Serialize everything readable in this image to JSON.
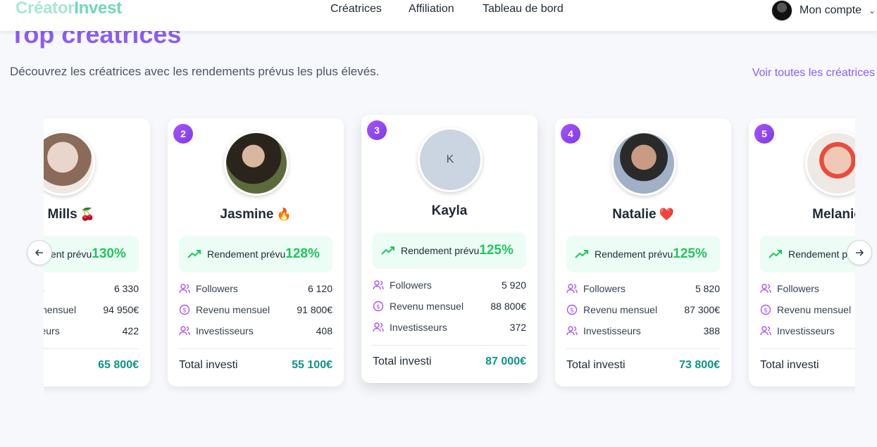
{
  "brand": {
    "part1": "Créator",
    "part2": "Invest"
  },
  "nav": {
    "links": [
      "Créatrices",
      "Affiliation",
      "Tableau de bord"
    ],
    "account_label": "Mon compte"
  },
  "page": {
    "title": "Top créatrices",
    "subtitle": "Découvrez les créatrices avec les rendements prévus les plus élevés.",
    "see_all": "Voir toutes les créatrices"
  },
  "labels": {
    "yield": "Rendement prévu",
    "followers": "Followers",
    "revenue": "Revenu mensuel",
    "investors": "Investisseurs",
    "total": "Total investi"
  },
  "creators": [
    {
      "rank": "",
      "name": "ke Mills",
      "emoji": "🍒",
      "yield": "130%",
      "followers": "6 330",
      "revenue": "94 950€",
      "investors": "422",
      "total": "65 800€",
      "initial": ""
    },
    {
      "rank": "2",
      "name": "Jasmine",
      "emoji": "🔥",
      "yield": "128%",
      "followers": "6 120",
      "revenue": "91 800€",
      "investors": "408",
      "total": "55 100€",
      "initial": ""
    },
    {
      "rank": "3",
      "name": "Kayla",
      "emoji": "",
      "yield": "125%",
      "followers": "5 920",
      "revenue": "88 800€",
      "investors": "372",
      "total": "87 000€",
      "initial": "K"
    },
    {
      "rank": "4",
      "name": "Natalie",
      "emoji": "❤️",
      "yield": "125%",
      "followers": "5 820",
      "revenue": "87 300€",
      "investors": "388",
      "total": "73 800€",
      "initial": ""
    },
    {
      "rank": "5",
      "name": "Melanie",
      "emoji": "",
      "yield": "",
      "followers": "",
      "revenue": "",
      "investors": "",
      "total": "",
      "initial": ""
    }
  ],
  "colors": {
    "accent": "#8b5cf6",
    "green": "#22c55e",
    "teal": "#0d9488",
    "brand_light": "#a7e8d2"
  },
  "icons": {
    "prev": "arrow-left-icon",
    "next": "arrow-right-icon",
    "trend": "trending-up-icon",
    "users": "users-icon",
    "money": "dollar-circle-icon",
    "chevron": "chevron-down-icon"
  }
}
